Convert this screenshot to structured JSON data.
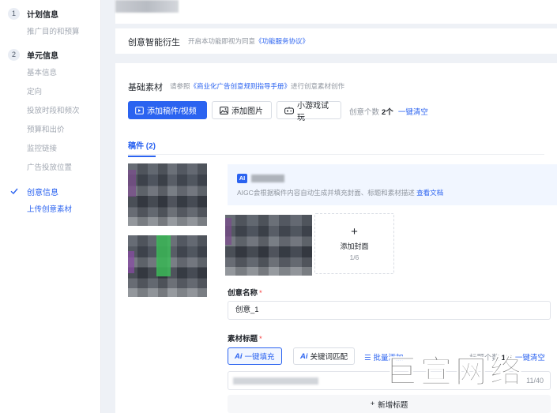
{
  "sidebar": {
    "steps": [
      {
        "num": "1",
        "title": "计划信息",
        "subs": [
          "推广目的和预算"
        ]
      },
      {
        "num": "2",
        "title": "单元信息",
        "subs": [
          "基本信息",
          "定向",
          "投放时段和频次",
          "预算和出价",
          "监控链接",
          "广告投放位置"
        ]
      }
    ],
    "step3": {
      "title": "创意信息",
      "sub": "上传创意素材"
    }
  },
  "aigc_card": {
    "title": "创意智能衍生",
    "desc_prefix": "开启本功能即视为同意",
    "desc_link": "《功能服务协议》"
  },
  "basic": {
    "title": "基础素材",
    "desc_prefix": "请参照",
    "desc_link": "《商业化广告创意规则指导手册》",
    "desc_suffix": "进行创意素材创作",
    "btn_add_video": "添加稿件/视频",
    "btn_add_image": "添加图片",
    "btn_mini_game": "小游戏试玩",
    "count_label": "创意个数",
    "count_value": "2个",
    "clear_all": "一键清空",
    "tab": "稿件 (2)"
  },
  "aigc_tip": {
    "badge": "AI",
    "desc": "AIGC会根据稿件内容自动生成并填充封面、标题和素材描述",
    "doc_link": "查看文档"
  },
  "cover": {
    "add_label": "添加封面",
    "count": "1/6"
  },
  "creative_name": {
    "label": "创意名称",
    "required": "*",
    "value": "创意_1"
  },
  "material_title": {
    "label": "素材标题",
    "required": "*",
    "chip_fill": "一键填充",
    "chip_keyword": "关键词匹配",
    "chip_ai": "Ai",
    "batch_add": "批量添加",
    "count_label": "标题个数",
    "count_value": "1/6",
    "clear": "一键清空",
    "char_count": "11/40",
    "add_title": "新增标题"
  },
  "watermark": "巨宣网络",
  "colors": {
    "accent": "#2b63f0",
    "required": "#f53f3f"
  }
}
